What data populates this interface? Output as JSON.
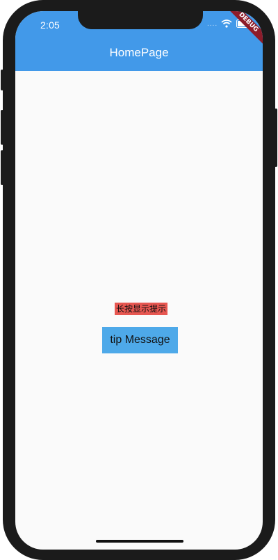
{
  "status_bar": {
    "time": "2:05",
    "signal": "....",
    "wifi_icon": "wifi-icon",
    "battery_icon": "battery-icon"
  },
  "debug_banner": "DEBUG",
  "app_bar": {
    "title": "HomePage",
    "color": "#4299e9"
  },
  "content": {
    "tip_label": "长按显示提示",
    "tip_label_bg": "#e75751",
    "tip_button_label": "tip Message",
    "tip_button_bg": "#4ea9e9"
  }
}
